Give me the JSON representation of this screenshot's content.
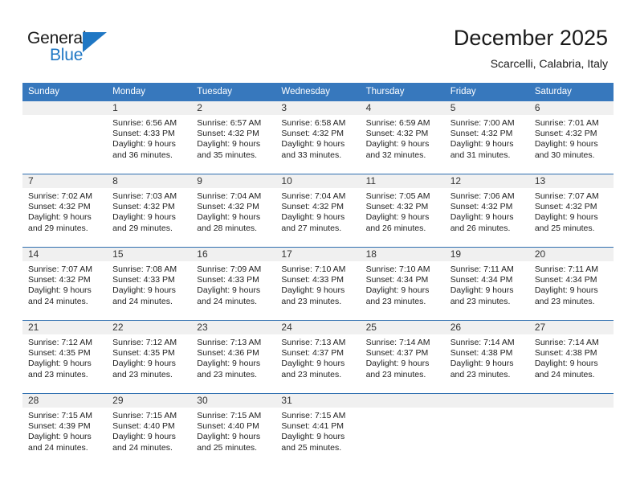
{
  "brand": {
    "word_one": "General",
    "word_two": "Blue",
    "flag_icon": "triangle-flag-icon"
  },
  "header": {
    "month_title": "December 2025",
    "location": "Scarcelli, Calabria, Italy"
  },
  "colors": {
    "header_blue": "#3778bd",
    "row_divider_blue": "#2f6fb0",
    "daynum_band": "#f0f0f0",
    "brand_blue": "#1f77c4",
    "text": "#222222"
  },
  "weekdays": [
    "Sunday",
    "Monday",
    "Tuesday",
    "Wednesday",
    "Thursday",
    "Friday",
    "Saturday"
  ],
  "weeks": [
    [
      {
        "day": "",
        "lines": []
      },
      {
        "day": "1",
        "lines": [
          "Sunrise: 6:56 AM",
          "Sunset: 4:33 PM",
          "Daylight: 9 hours",
          "and 36 minutes."
        ]
      },
      {
        "day": "2",
        "lines": [
          "Sunrise: 6:57 AM",
          "Sunset: 4:32 PM",
          "Daylight: 9 hours",
          "and 35 minutes."
        ]
      },
      {
        "day": "3",
        "lines": [
          "Sunrise: 6:58 AM",
          "Sunset: 4:32 PM",
          "Daylight: 9 hours",
          "and 33 minutes."
        ]
      },
      {
        "day": "4",
        "lines": [
          "Sunrise: 6:59 AM",
          "Sunset: 4:32 PM",
          "Daylight: 9 hours",
          "and 32 minutes."
        ]
      },
      {
        "day": "5",
        "lines": [
          "Sunrise: 7:00 AM",
          "Sunset: 4:32 PM",
          "Daylight: 9 hours",
          "and 31 minutes."
        ]
      },
      {
        "day": "6",
        "lines": [
          "Sunrise: 7:01 AM",
          "Sunset: 4:32 PM",
          "Daylight: 9 hours",
          "and 30 minutes."
        ]
      }
    ],
    [
      {
        "day": "7",
        "lines": [
          "Sunrise: 7:02 AM",
          "Sunset: 4:32 PM",
          "Daylight: 9 hours",
          "and 29 minutes."
        ]
      },
      {
        "day": "8",
        "lines": [
          "Sunrise: 7:03 AM",
          "Sunset: 4:32 PM",
          "Daylight: 9 hours",
          "and 29 minutes."
        ]
      },
      {
        "day": "9",
        "lines": [
          "Sunrise: 7:04 AM",
          "Sunset: 4:32 PM",
          "Daylight: 9 hours",
          "and 28 minutes."
        ]
      },
      {
        "day": "10",
        "lines": [
          "Sunrise: 7:04 AM",
          "Sunset: 4:32 PM",
          "Daylight: 9 hours",
          "and 27 minutes."
        ]
      },
      {
        "day": "11",
        "lines": [
          "Sunrise: 7:05 AM",
          "Sunset: 4:32 PM",
          "Daylight: 9 hours",
          "and 26 minutes."
        ]
      },
      {
        "day": "12",
        "lines": [
          "Sunrise: 7:06 AM",
          "Sunset: 4:32 PM",
          "Daylight: 9 hours",
          "and 26 minutes."
        ]
      },
      {
        "day": "13",
        "lines": [
          "Sunrise: 7:07 AM",
          "Sunset: 4:32 PM",
          "Daylight: 9 hours",
          "and 25 minutes."
        ]
      }
    ],
    [
      {
        "day": "14",
        "lines": [
          "Sunrise: 7:07 AM",
          "Sunset: 4:32 PM",
          "Daylight: 9 hours",
          "and 24 minutes."
        ]
      },
      {
        "day": "15",
        "lines": [
          "Sunrise: 7:08 AM",
          "Sunset: 4:33 PM",
          "Daylight: 9 hours",
          "and 24 minutes."
        ]
      },
      {
        "day": "16",
        "lines": [
          "Sunrise: 7:09 AM",
          "Sunset: 4:33 PM",
          "Daylight: 9 hours",
          "and 24 minutes."
        ]
      },
      {
        "day": "17",
        "lines": [
          "Sunrise: 7:10 AM",
          "Sunset: 4:33 PM",
          "Daylight: 9 hours",
          "and 23 minutes."
        ]
      },
      {
        "day": "18",
        "lines": [
          "Sunrise: 7:10 AM",
          "Sunset: 4:34 PM",
          "Daylight: 9 hours",
          "and 23 minutes."
        ]
      },
      {
        "day": "19",
        "lines": [
          "Sunrise: 7:11 AM",
          "Sunset: 4:34 PM",
          "Daylight: 9 hours",
          "and 23 minutes."
        ]
      },
      {
        "day": "20",
        "lines": [
          "Sunrise: 7:11 AM",
          "Sunset: 4:34 PM",
          "Daylight: 9 hours",
          "and 23 minutes."
        ]
      }
    ],
    [
      {
        "day": "21",
        "lines": [
          "Sunrise: 7:12 AM",
          "Sunset: 4:35 PM",
          "Daylight: 9 hours",
          "and 23 minutes."
        ]
      },
      {
        "day": "22",
        "lines": [
          "Sunrise: 7:12 AM",
          "Sunset: 4:35 PM",
          "Daylight: 9 hours",
          "and 23 minutes."
        ]
      },
      {
        "day": "23",
        "lines": [
          "Sunrise: 7:13 AM",
          "Sunset: 4:36 PM",
          "Daylight: 9 hours",
          "and 23 minutes."
        ]
      },
      {
        "day": "24",
        "lines": [
          "Sunrise: 7:13 AM",
          "Sunset: 4:37 PM",
          "Daylight: 9 hours",
          "and 23 minutes."
        ]
      },
      {
        "day": "25",
        "lines": [
          "Sunrise: 7:14 AM",
          "Sunset: 4:37 PM",
          "Daylight: 9 hours",
          "and 23 minutes."
        ]
      },
      {
        "day": "26",
        "lines": [
          "Sunrise: 7:14 AM",
          "Sunset: 4:38 PM",
          "Daylight: 9 hours",
          "and 23 minutes."
        ]
      },
      {
        "day": "27",
        "lines": [
          "Sunrise: 7:14 AM",
          "Sunset: 4:38 PM",
          "Daylight: 9 hours",
          "and 24 minutes."
        ]
      }
    ],
    [
      {
        "day": "28",
        "lines": [
          "Sunrise: 7:15 AM",
          "Sunset: 4:39 PM",
          "Daylight: 9 hours",
          "and 24 minutes."
        ]
      },
      {
        "day": "29",
        "lines": [
          "Sunrise: 7:15 AM",
          "Sunset: 4:40 PM",
          "Daylight: 9 hours",
          "and 24 minutes."
        ]
      },
      {
        "day": "30",
        "lines": [
          "Sunrise: 7:15 AM",
          "Sunset: 4:40 PM",
          "Daylight: 9 hours",
          "and 25 minutes."
        ]
      },
      {
        "day": "31",
        "lines": [
          "Sunrise: 7:15 AM",
          "Sunset: 4:41 PM",
          "Daylight: 9 hours",
          "and 25 minutes."
        ]
      },
      {
        "day": "",
        "lines": []
      },
      {
        "day": "",
        "lines": []
      },
      {
        "day": "",
        "lines": []
      }
    ]
  ]
}
